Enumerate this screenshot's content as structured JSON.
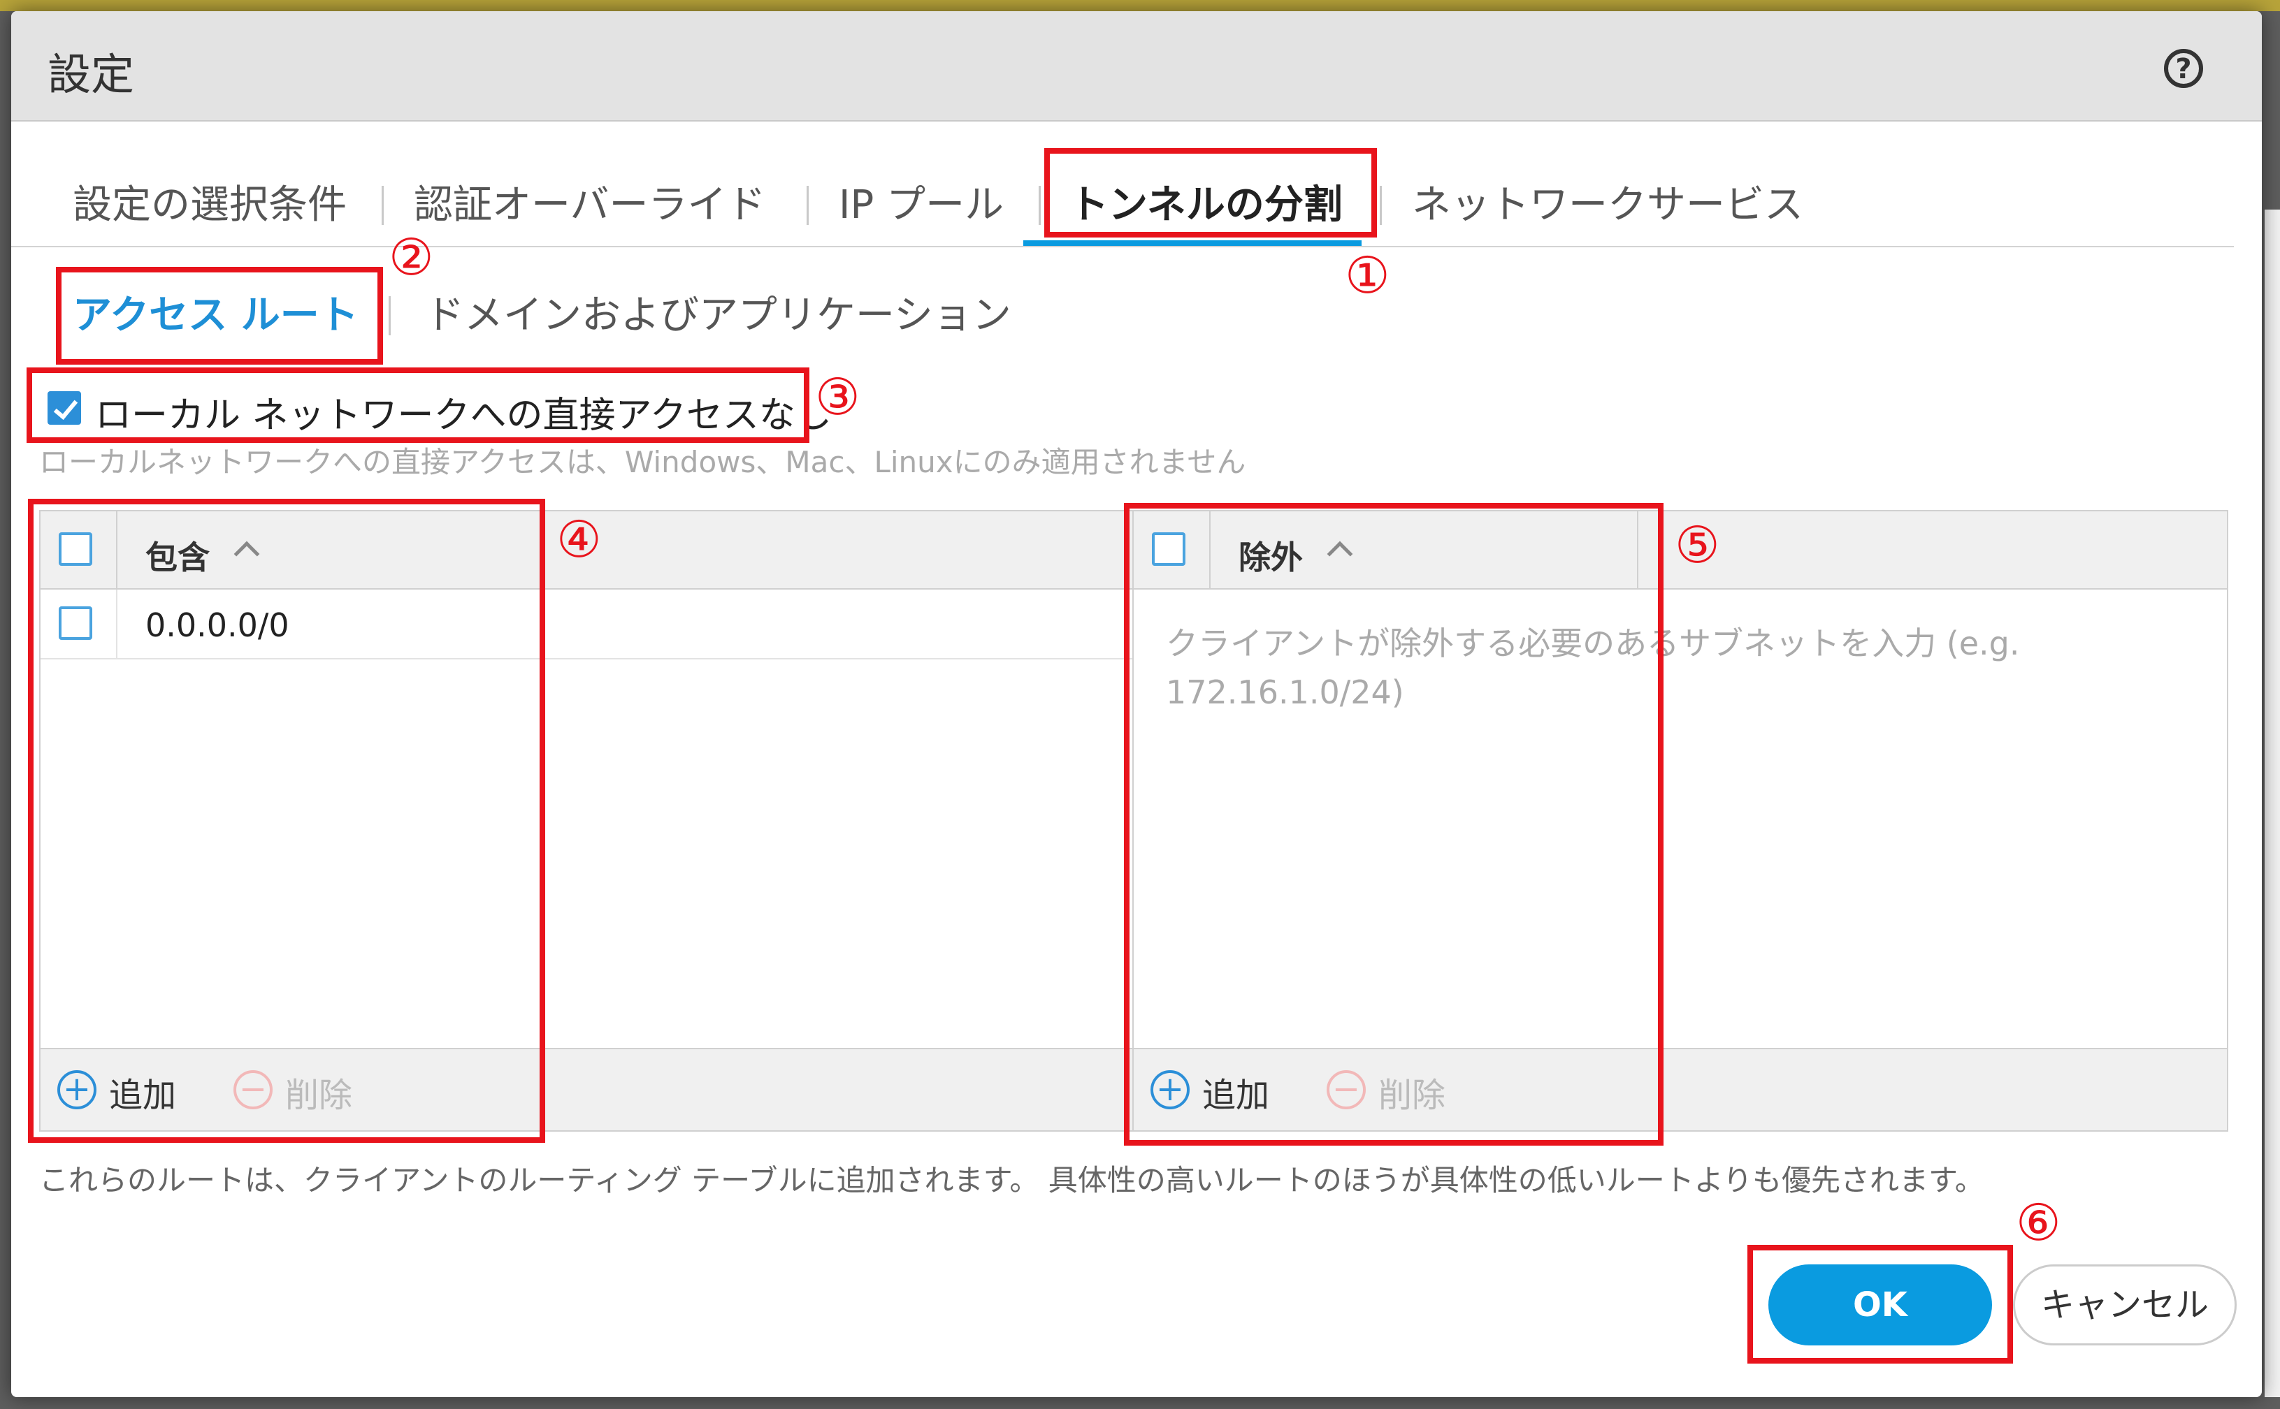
{
  "dialog": {
    "title": "設定",
    "help_icon": "help-icon"
  },
  "tabs": [
    {
      "label": "設定の選択条件"
    },
    {
      "label": "認証オーバーライド"
    },
    {
      "label": "IP プール"
    },
    {
      "label": "トンネルの分割",
      "active": true
    },
    {
      "label": "ネットワークサービス"
    }
  ],
  "subtabs": [
    {
      "label": "アクセス ルート",
      "active": true
    },
    {
      "label": "ドメインおよびアプリケーション"
    }
  ],
  "no_direct_access": {
    "label": "ローカル ネットワークへの直接アクセスなし",
    "checked": true,
    "hint": "ローカルネットワークへの直接アクセスは、Windows、Mac、Linuxにのみ適用されません"
  },
  "include_grid": {
    "column": "包含",
    "rows": [
      "0.0.0.0/0"
    ],
    "add_label": "追加",
    "remove_label": "削除"
  },
  "exclude_grid": {
    "column": "除外",
    "placeholder_line1": "クライアントが除外する必要のあるサブネットを入力 (e.g.",
    "placeholder_line2": "172.16.1.0/24)",
    "add_label": "追加",
    "remove_label": "削除"
  },
  "route_hint": "これらのルートは、クライアントのルーティング テーブルに追加されます。 具体性の高いルートのほうが具体性の低いルートよりも優先されます。",
  "buttons": {
    "ok": "OK",
    "cancel": "キャンセル"
  },
  "annotations": [
    "①",
    "②",
    "③",
    "④",
    "⑤",
    "⑥"
  ],
  "colors": {
    "accent": "#0a9be0",
    "annotation": "#e8141c"
  }
}
